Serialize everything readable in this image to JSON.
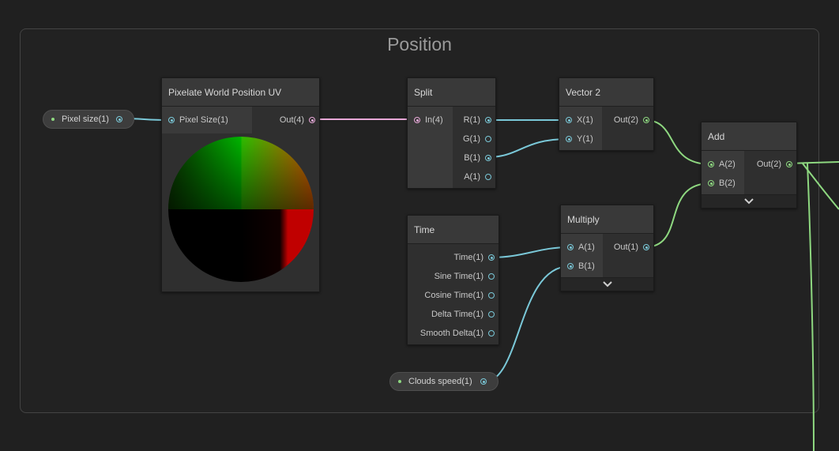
{
  "group": {
    "title": "Position"
  },
  "nodes": {
    "pixelate": {
      "title": "Pixelate World Position UV",
      "input": "Pixel Size(1)",
      "output": "Out(4)"
    },
    "split": {
      "title": "Split",
      "input": "In(4)",
      "outputs": [
        "R(1)",
        "G(1)",
        "B(1)",
        "A(1)"
      ]
    },
    "vector2": {
      "title": "Vector 2",
      "inputs": [
        "X(1)",
        "Y(1)"
      ],
      "output": "Out(2)"
    },
    "add": {
      "title": "Add",
      "inputs": [
        "A(2)",
        "B(2)"
      ],
      "output": "Out(2)"
    },
    "time": {
      "title": "Time",
      "outputs": [
        "Time(1)",
        "Sine Time(1)",
        "Cosine Time(1)",
        "Delta Time(1)",
        "Smooth Delta(1)"
      ]
    },
    "multiply": {
      "title": "Multiply",
      "inputs": [
        "A(1)",
        "B(1)"
      ],
      "output": "Out(1)"
    }
  },
  "properties": {
    "pixel_size": "Pixel size(1)",
    "clouds_speed": "Clouds speed(1)"
  },
  "icons": {
    "expand": "chevron-down-icon"
  },
  "colors": {
    "wire_float": "#7ac8d8",
    "wire_vector4": "#e8a8d8",
    "wire_vector2": "#8ed880"
  }
}
